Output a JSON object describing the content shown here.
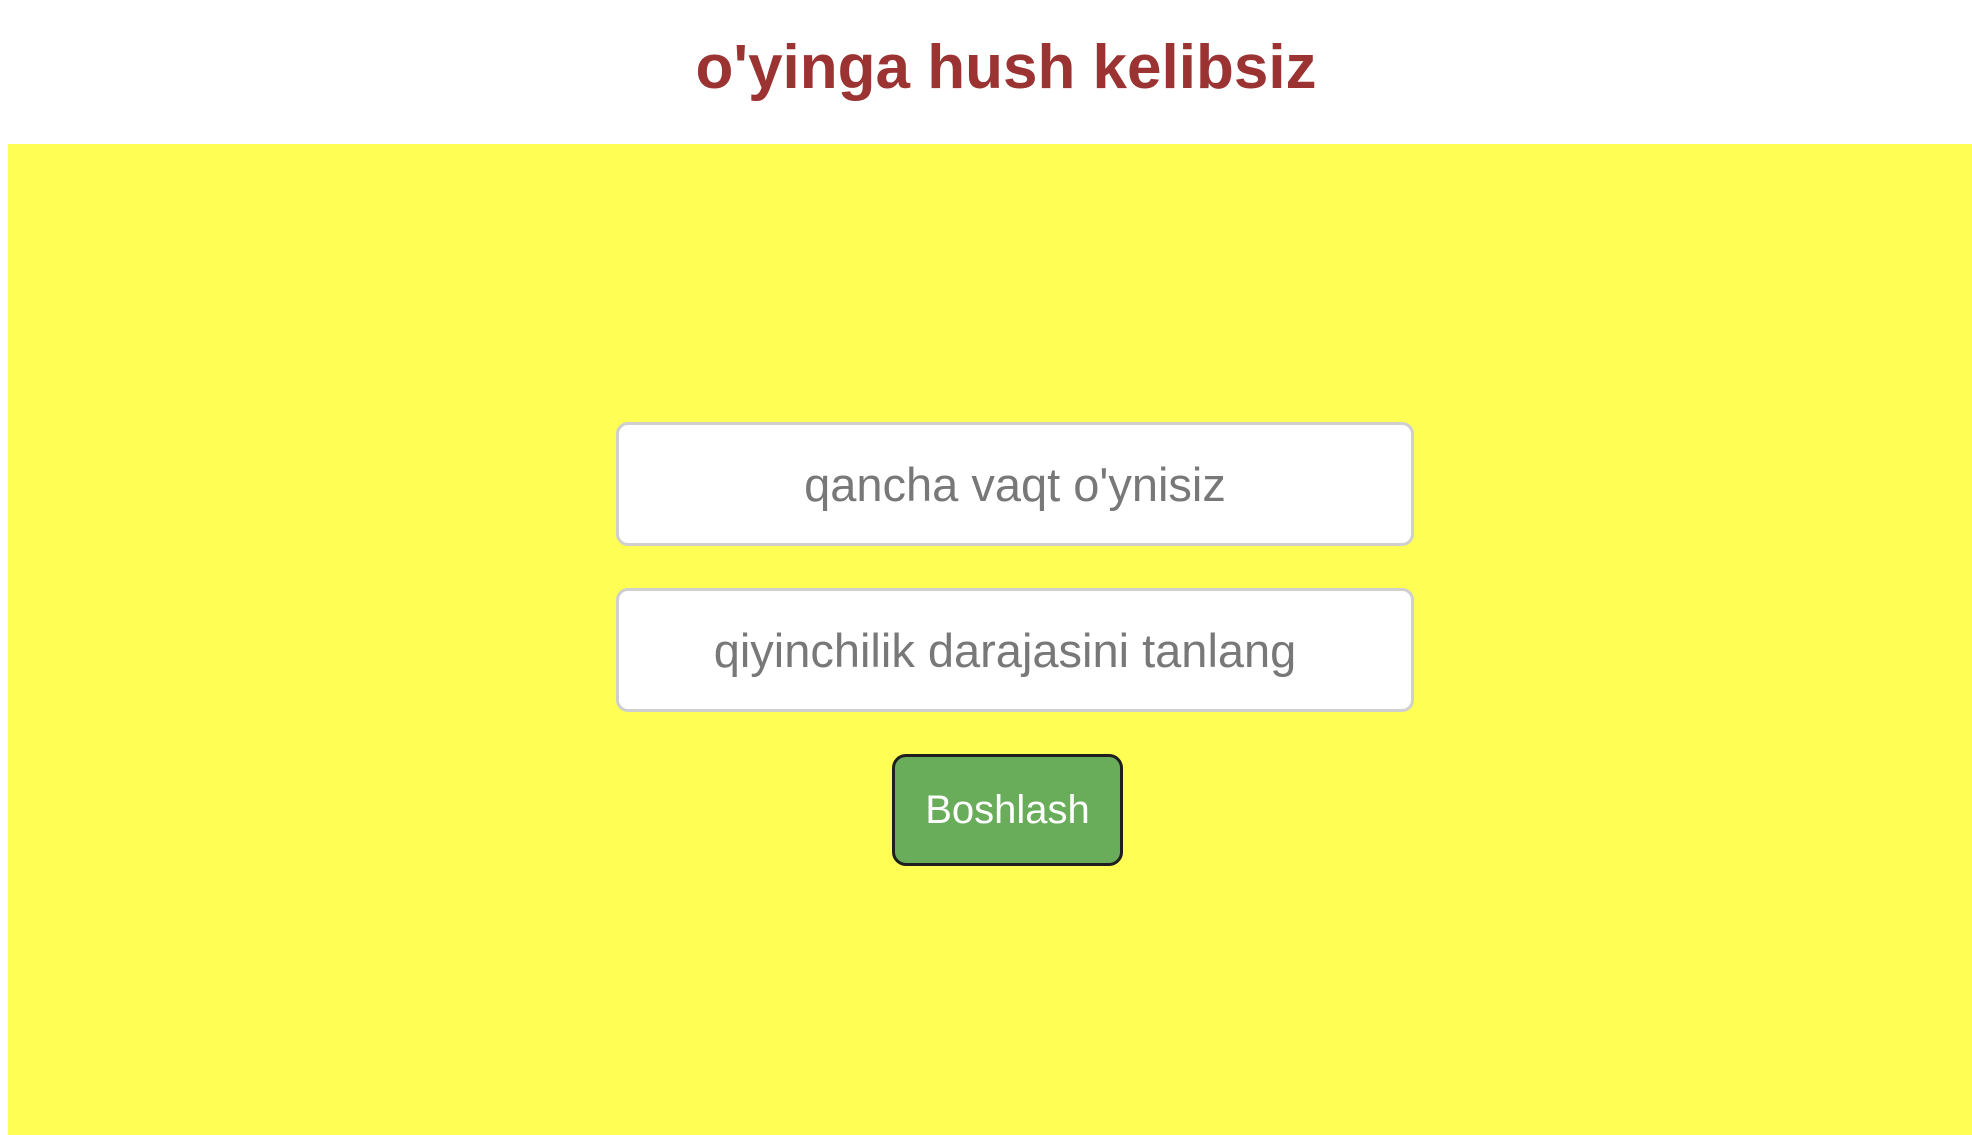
{
  "header": {
    "title": "o'yinga hush kelibsiz"
  },
  "form": {
    "time_placeholder": "qancha vaqt o'ynisiz",
    "difficulty_placeholder": "qiyinchilik darajasini tanlang",
    "start_label": "Boshlash"
  },
  "colors": {
    "title": "#9b3333",
    "panel_background": "#fffe55",
    "button_background": "#69ad5a",
    "input_border": "#cfcfcf"
  }
}
